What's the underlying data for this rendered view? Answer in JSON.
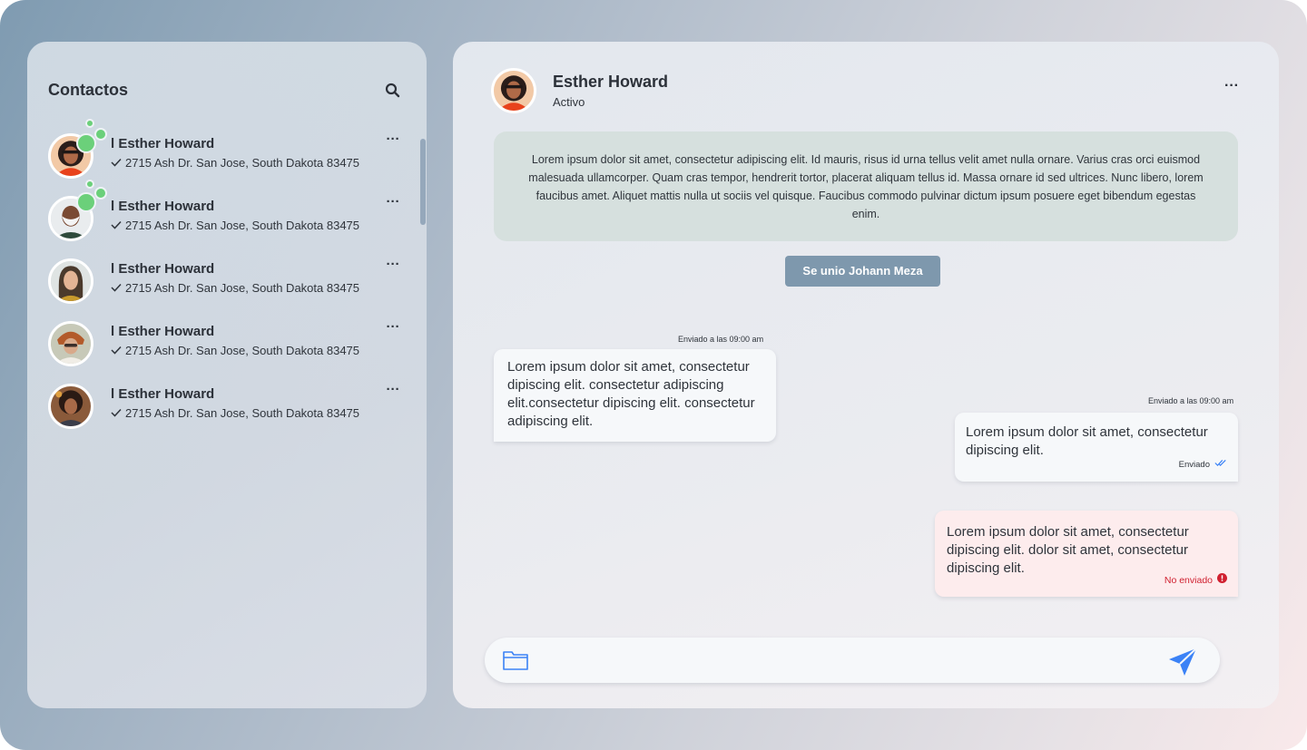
{
  "contacts": {
    "title": "Contactos",
    "items": [
      {
        "name": "l Esther Howard",
        "address": "2715 Ash Dr. San Jose, South Dakota 83475",
        "online": true
      },
      {
        "name": "l Esther Howard",
        "address": "2715 Ash Dr. San Jose, South Dakota 83475",
        "online": true
      },
      {
        "name": "l Esther Howard",
        "address": "2715 Ash Dr. San Jose, South Dakota 83475",
        "online": false
      },
      {
        "name": "l Esther Howard",
        "address": "2715 Ash Dr. San Jose, South Dakota 83475",
        "online": false
      },
      {
        "name": "l Esther Howard",
        "address": "2715 Ash Dr. San Jose, South Dakota 83475",
        "online": false
      }
    ],
    "more_label": "···"
  },
  "chat": {
    "name": "Esther Howard",
    "status": "Activo",
    "more_label": "···",
    "info_text": "Lorem ipsum dolor sit amet, consectetur adipiscing elit. Id mauris, risus id urna tellus velit amet nulla ornare. Varius cras orci euismod malesuada ullamcorper. Quam cras tempor, hendrerit tortor, placerat aliquam tellus id. Massa ornare id sed ultrices. Nunc libero, lorem faucibus amet. Aliquet mattis nulla ut sociis vel quisque. Faucibus commodo pulvinar dictum ipsum posuere eget bibendum egestas enim.",
    "join_notice": "Se unio Johann Meza",
    "messages": [
      {
        "timestamp": "Enviado a las 09:00 am",
        "text": "Lorem ipsum dolor sit amet, consectetur dipiscing elit. consectetur adipiscing elit.consectetur dipiscing elit. consectetur adipiscing elit.",
        "direction": "incoming"
      },
      {
        "timestamp": "Enviado a las 09:00 am",
        "text": "Lorem ipsum dolor sit amet, consectetur dipiscing elit.",
        "direction": "outgoing",
        "status": "Enviado"
      },
      {
        "text": "Lorem ipsum dolor sit amet, consectetur dipiscing elit. dolor sit amet, consectetur dipiscing elit.",
        "direction": "outgoing",
        "status": "No enviado"
      }
    ],
    "input": {
      "value": "",
      "placeholder": ""
    }
  },
  "colors": {
    "accent": "#3b82f6",
    "online": "#6bd07a",
    "error": "#d01f2f",
    "join_badge": "#7e98ad",
    "info_card": "#d6e0de"
  },
  "icons": {
    "search": "search-icon",
    "more": "more-icon",
    "check": "check-icon",
    "double_check": "double-check-icon",
    "error": "error-icon",
    "folder": "folder-icon",
    "send": "send-icon"
  }
}
